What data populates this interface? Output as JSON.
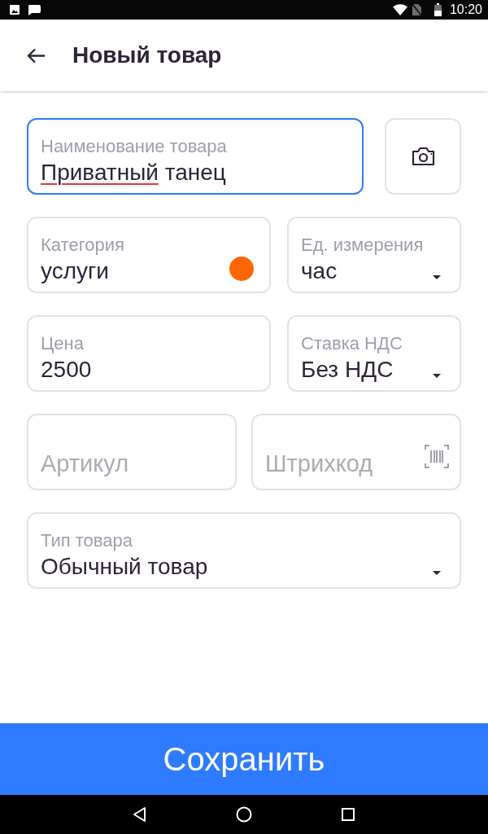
{
  "status_bar": {
    "time": "10:20"
  },
  "app_bar": {
    "title": "Новый товар"
  },
  "form": {
    "rows": [
      {
        "fields": [
          {
            "kind": "text",
            "label": "Наименование товара",
            "value": [
              {
                "text": "Приватный",
                "misspelled": true
              },
              {
                "text": " танец",
                "misspelled": false
              }
            ],
            "focused": true
          },
          {
            "kind": "photo"
          }
        ]
      },
      {
        "fields": [
          {
            "kind": "text",
            "label": "Категория",
            "value": "услуги",
            "color": "#ff6600",
            "focused": false
          },
          {
            "kind": "select",
            "label": "Ед. измерения",
            "value": "час",
            "focused": false
          }
        ]
      },
      {
        "fields": [
          {
            "kind": "text",
            "label": "Цена",
            "value": "2500",
            "focused": false
          },
          {
            "kind": "select",
            "label": "Ставка НДС",
            "value": "Без НДС",
            "focused": false
          }
        ]
      },
      {
        "fields": [
          {
            "kind": "text",
            "placeholder": "Артикул",
            "focused": false
          },
          {
            "kind": "barcode",
            "placeholder": "Штрихкод",
            "focused": false
          }
        ]
      },
      {
        "fields": [
          {
            "kind": "select",
            "label": "Тип товара",
            "value": "Обычный товар",
            "focused": false
          }
        ]
      }
    ]
  },
  "save_button": {
    "label": "Сохранить"
  }
}
